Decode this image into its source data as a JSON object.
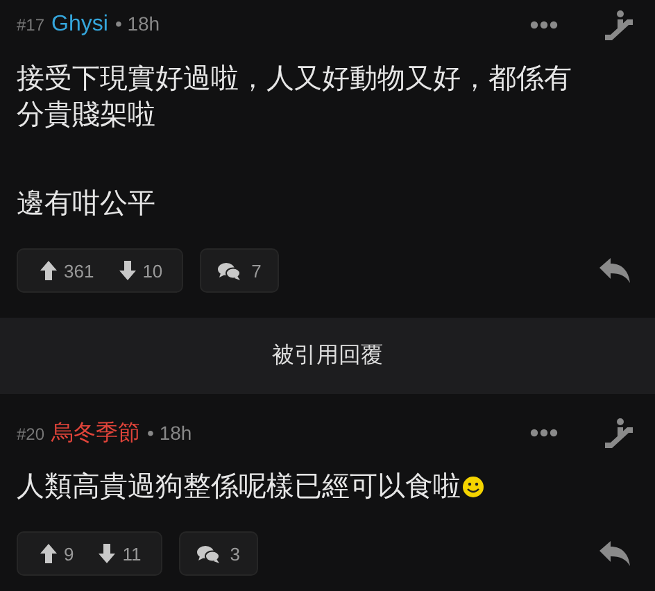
{
  "posts": [
    {
      "kind": "comment",
      "number": "#17",
      "author": "Ghysi",
      "color": "#35a6dc",
      "time": "• 18h",
      "paragraphs": [
        {
          "text": "接受下現實好過啦，人又好動物又好，都係有分貴賤架啦",
          "emoji": false
        },
        {
          "text": "邊有咁公平",
          "emoji": false
        }
      ],
      "upvotes": "361",
      "downvotes": "10",
      "replies": "7"
    },
    {
      "kind": "quote_bar",
      "label": "被引用回覆"
    },
    {
      "kind": "comment",
      "number": "#20",
      "author": "烏冬季節",
      "color": "#e0443a",
      "time": "• 18h",
      "paragraphs": [
        {
          "text": "人類高貴過狗整係呢樣已經可以食啦",
          "emoji": true
        }
      ],
      "upvotes": "9",
      "downvotes": "11",
      "replies": "3"
    }
  ]
}
